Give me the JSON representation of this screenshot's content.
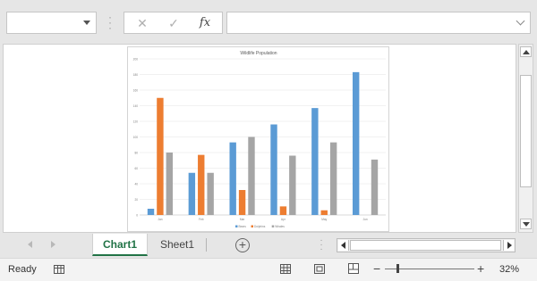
{
  "formula_bar": {
    "cancel_icon": "✕",
    "enter_icon": "✓",
    "fx_label": "fx"
  },
  "chart_data": {
    "type": "bar",
    "title": "Wildlife Population",
    "categories": [
      "Jan",
      "Feb",
      "Mar",
      "Apr",
      "May",
      "Jun"
    ],
    "series": [
      {
        "name": "Bears",
        "color": "#5b9bd5",
        "values": [
          8,
          54,
          93,
          116,
          137,
          183
        ]
      },
      {
        "name": "Dolphins",
        "color": "#ed7d31",
        "values": [
          150,
          77,
          32,
          11,
          6,
          0
        ]
      },
      {
        "name": "Whales",
        "color": "#a5a5a5",
        "values": [
          80,
          54,
          100,
          76,
          93,
          71
        ]
      }
    ],
    "ylim": [
      0,
      200
    ],
    "yticks": [
      "0",
      "20",
      "40",
      "60",
      "80",
      "100",
      "120",
      "140",
      "160",
      "180",
      "200"
    ],
    "grid": true,
    "legend_position": "bottom"
  },
  "tabs": [
    {
      "label": "Chart1",
      "active": true
    },
    {
      "label": "Sheet1",
      "active": false
    }
  ],
  "status": {
    "ready": "Ready",
    "zoom": "32%",
    "zoom_value": 0.32
  },
  "colors": {
    "accent": "#217346"
  }
}
